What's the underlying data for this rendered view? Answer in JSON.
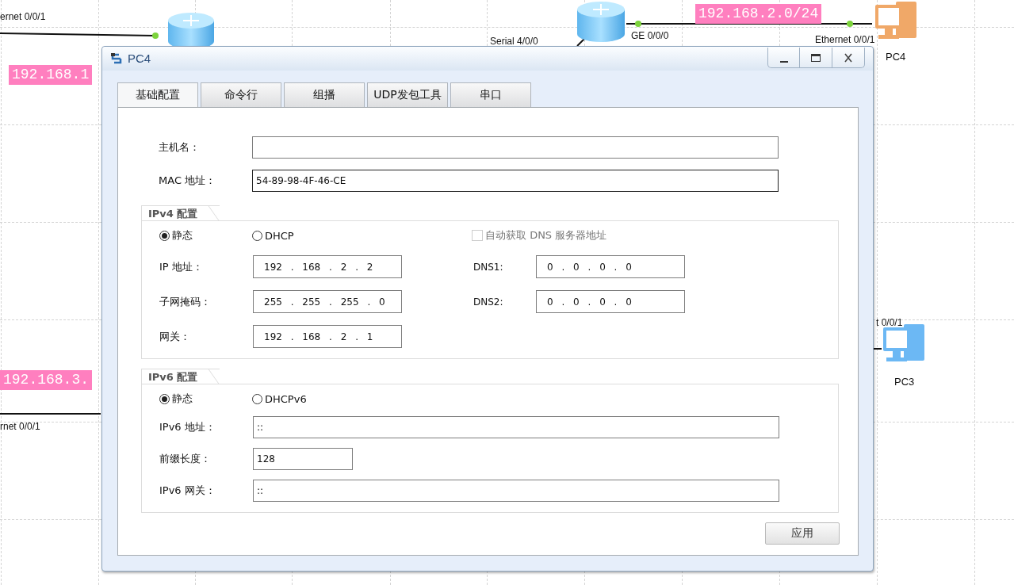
{
  "topology": {
    "nodes": [
      {
        "kind": "router"
      },
      {
        "kind": "router"
      },
      {
        "kind": "pc",
        "label": "PC4",
        "color": "#f0a868"
      },
      {
        "kind": "pc",
        "label": "PC3",
        "color": "#6cb8f4"
      }
    ],
    "port_labels": [
      "ernet 0/0/1",
      "Serial 4/0/0",
      "GE 0/0/0",
      "Ethernet 0/0/1",
      "t 0/0/1",
      "rnet 0/0/1"
    ],
    "network_labels": [
      "192.168.1",
      "192.168.2.0/24",
      "192.168.3."
    ]
  },
  "window": {
    "title": "PC4"
  },
  "tabs": [
    {
      "label": "基础配置",
      "selected": true
    },
    {
      "label": "命令行",
      "selected": false
    },
    {
      "label": "组播",
      "selected": false
    },
    {
      "label": "UDP发包工具",
      "selected": false
    },
    {
      "label": "串口",
      "selected": false
    }
  ],
  "basic": [
    {
      "label": "主机名：",
      "focused": false
    },
    {
      "label": "MAC 地址：",
      "value": "54-89-98-4F-46-CE",
      "focused": true
    }
  ],
  "ipv4": {
    "title": "IPv4 配置",
    "modes": [
      {
        "label": "静态",
        "selected": true
      },
      {
        "label": "DHCP",
        "selected": false
      }
    ],
    "auto_dns": {
      "label": "自动获取 DNS 服务器地址",
      "checked": false,
      "disabled": true
    },
    "fields": [
      {
        "label": "IP 地址：",
        "value": "192 . 168 . 2 . 2"
      },
      {
        "label": "子网掩码：",
        "value": "255 . 255 . 255 . 0"
      },
      {
        "label": "网关：",
        "value": "192 . 168 . 2 . 1"
      }
    ],
    "dns": [
      {
        "label": "DNS1:",
        "value": "0 . 0 . 0 . 0"
      },
      {
        "label": "DNS2:",
        "value": "0 . 0 . 0 . 0"
      }
    ]
  },
  "ipv6": {
    "title": "IPv6 配置",
    "modes": [
      {
        "label": "静态",
        "selected": true
      },
      {
        "label": "DHCPv6",
        "selected": false
      }
    ],
    "fields": [
      {
        "label": "IPv6 地址：",
        "value": "::",
        "kind": "wide"
      },
      {
        "label": "前缀长度：",
        "value": "128",
        "kind": "short"
      },
      {
        "label": "IPv6 网关：",
        "value": "::",
        "kind": "wide"
      }
    ]
  },
  "apply_button": "应用"
}
